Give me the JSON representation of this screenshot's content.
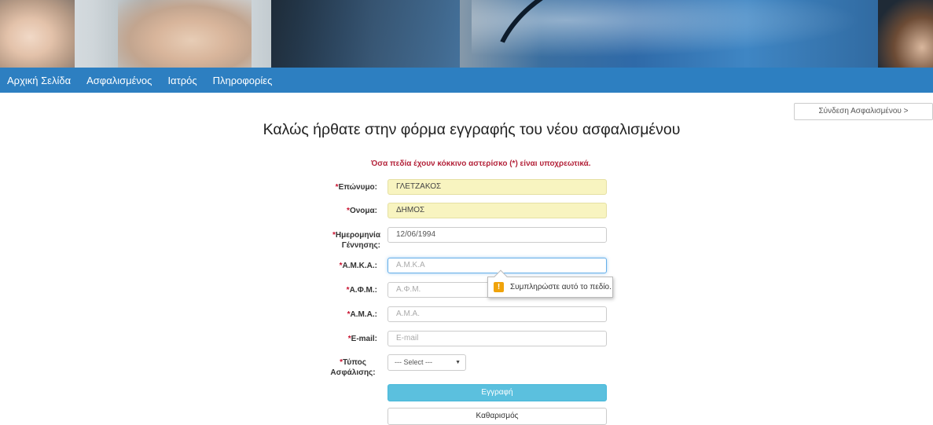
{
  "nav": {
    "items": [
      {
        "label": "Αρχική Σελίδα"
      },
      {
        "label": "Ασφαλισμένος"
      },
      {
        "label": "Ιατρός"
      },
      {
        "label": "Πληροφορίες"
      }
    ]
  },
  "login_button": "Σύνδεση Ασφαλισμένου >",
  "page_title": "Καλώς ήρθατε στην φόρμα εγγραφής του νέου ασφαλισμένου",
  "required_note": "Όσα πεδία έχουν κόκκινο αστερίσκο (*) είναι υποχρεωτικά.",
  "form": {
    "asterisk": "*",
    "surname": {
      "label": "Επώνυμο:",
      "value": "ΓΛΕΤΖΑΚΟΣ"
    },
    "name": {
      "label": "Ονομα:",
      "value": "ΔΗΜΟΣ"
    },
    "birthdate": {
      "label_line1": "Ημερομηνία",
      "label_line2": "Γέννησης:",
      "value": "12/06/1994"
    },
    "amka": {
      "label": "Α.Μ.Κ.Α.:",
      "placeholder": "A.M.K.A"
    },
    "afm": {
      "label": "Α.Φ.Μ.:",
      "placeholder": "Α.Φ.Μ."
    },
    "ama": {
      "label": "Α.Μ.Α.:",
      "placeholder": "Α.Μ.Α."
    },
    "email": {
      "label": "E-mail:",
      "placeholder": "E-mail"
    },
    "insurance_type": {
      "label_line1": "Τύπος",
      "label_line2": "Ασφάλισης:",
      "selected": "--- Select ---"
    },
    "submit_label": "Εγγραφή",
    "reset_label": "Καθαρισμός"
  },
  "validation_tooltip": {
    "icon": "warning-icon",
    "icon_glyph": "!",
    "text": "Συμπληρώστε αυτό το πεδίο."
  },
  "colors": {
    "nav_bg": "#2d7fc1",
    "required_red": "#b4243b",
    "filled_field_bg": "#f8f4c0",
    "submit_bg": "#5bc0de"
  }
}
